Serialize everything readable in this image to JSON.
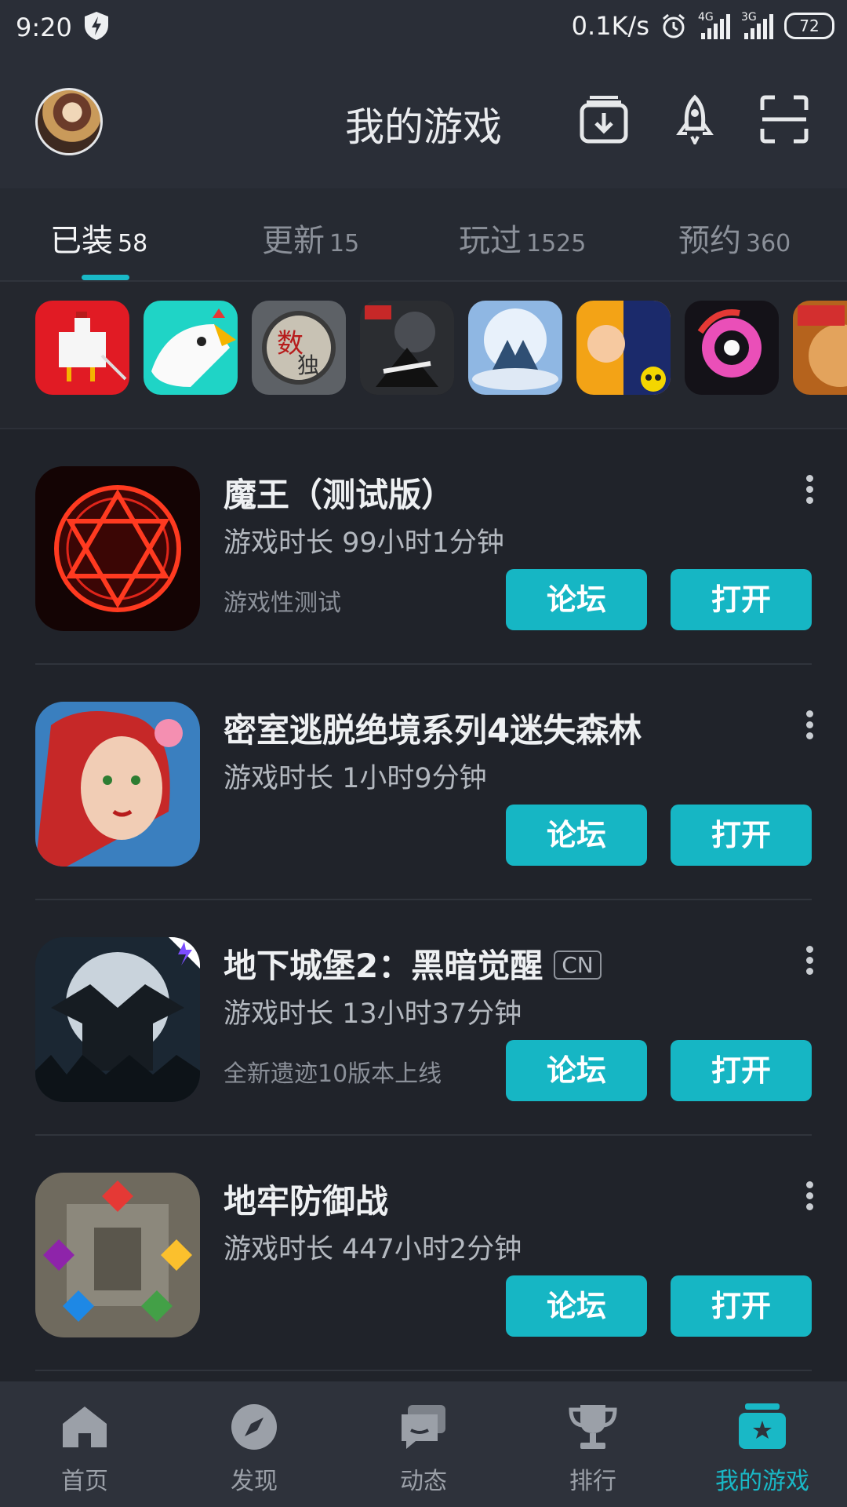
{
  "status_bar": {
    "time": "9:20",
    "network_speed": "0.1K/s",
    "signal_1_label": "4G",
    "signal_2_label": "3G",
    "battery": "72"
  },
  "header": {
    "title": "我的游戏",
    "icons": [
      "download-icon",
      "rocket-icon",
      "scan-icon"
    ]
  },
  "tabs": [
    {
      "label": "已装",
      "count": "58",
      "active": true
    },
    {
      "label": "更新",
      "count": "15",
      "active": false
    },
    {
      "label": "玩过",
      "count": "1525",
      "active": false
    },
    {
      "label": "预约",
      "count": "360",
      "active": false
    }
  ],
  "game_rows": [
    {
      "title": "魔王（测试版）",
      "playtime": "游戏时长 99小时1分钟",
      "note": "游戏性测试",
      "tag": ""
    },
    {
      "title": "密室逃脱绝境系列4迷失森林",
      "playtime": "游戏时长 1小时9分钟",
      "note": "",
      "tag": ""
    },
    {
      "title": "地下城堡2：黑暗觉醒",
      "playtime": "游戏时长 13小时37分钟",
      "note": "全新遗迹10版本上线",
      "tag": "CN"
    },
    {
      "title": "地牢防御战",
      "playtime": "游戏时长 447小时2分钟",
      "note": "",
      "tag": ""
    }
  ],
  "buttons": {
    "forum": "论坛",
    "open": "打开"
  },
  "bottom_nav": [
    {
      "label": "首页",
      "icon": "home-icon",
      "active": false
    },
    {
      "label": "发现",
      "icon": "compass-icon",
      "active": false
    },
    {
      "label": "动态",
      "icon": "chat-icon",
      "active": false
    },
    {
      "label": "排行",
      "icon": "trophy-icon",
      "active": false
    },
    {
      "label": "我的游戏",
      "icon": "my-games-icon",
      "active": true
    }
  ],
  "colors": {
    "accent": "#16b6c4",
    "background": "#20232a",
    "header": "#2a2e37"
  }
}
